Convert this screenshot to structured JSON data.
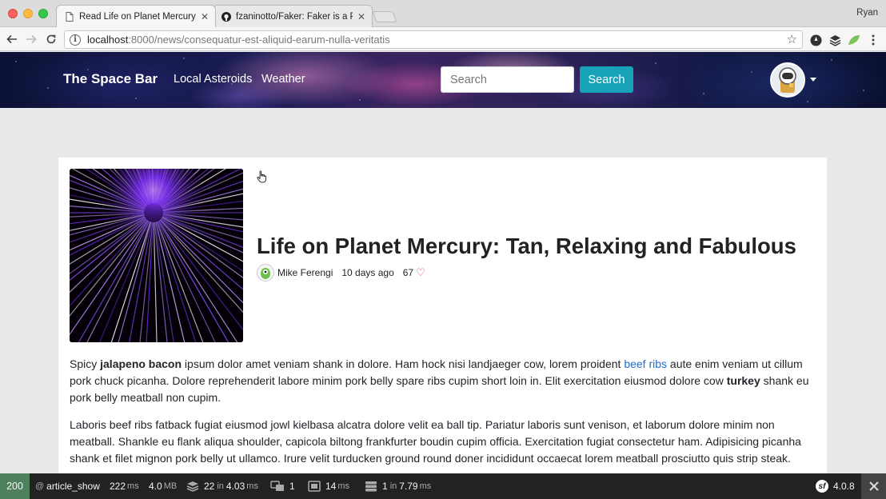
{
  "browser": {
    "tabs": [
      {
        "title": "Read Life on Planet Mercury: T",
        "active": true
      },
      {
        "title": "fzaninotto/Faker: Faker is a PH",
        "active": false
      }
    ],
    "user": "Ryan",
    "url": {
      "host": "localhost",
      "path": ":8000/news/consequatur-est-aliquid-earum-nulla-veritatis"
    }
  },
  "site": {
    "brand": "The Space Bar",
    "nav": [
      "Local Asteroids",
      "Weather"
    ],
    "search": {
      "placeholder": "Search",
      "button": "Search"
    }
  },
  "article": {
    "title": "Life on Planet Mercury: Tan, Relaxing and Fabulous",
    "author": "Mike Ferengi",
    "published": "10 days ago",
    "hearts": "67",
    "p1": {
      "a": "Spicy ",
      "b1": "jalapeno bacon",
      "c": " ipsum dolor amet veniam shank in dolore. Ham hock nisi landjaeger cow, lorem proident ",
      "link": "beef ribs",
      "d": " aute enim veniam ut cillum pork chuck picanha. Dolore reprehenderit labore minim pork belly spare ribs cupim short loin in. Elit exercitation eiusmod dolore cow ",
      "b2": "turkey",
      "e": " shank eu pork belly meatball non cupim."
    },
    "p2": "Laboris beef ribs fatback fugiat eiusmod jowl kielbasa alcatra dolore velit ea ball tip. Pariatur laboris sunt venison, et laborum dolore minim non meatball. Shankle eu flank aliqua shoulder, capicola biltong frankfurter boudin cupim officia. Exercitation fugiat consectetur ham. Adipisicing picanha shank et filet mignon pork belly ut ullamco. Irure velit turducken ground round doner incididunt occaecat lorem meatball prosciutto quis strip steak."
  },
  "profiler": {
    "status": "200",
    "route_prefix": "@",
    "route": "article_show",
    "time": "222",
    "time_unit": "ms",
    "memory": "4.0",
    "memory_unit": "MB",
    "db_queries": "22",
    "db_in": "in",
    "db_time": "4.03",
    "db_unit": "ms",
    "translations": "1",
    "render_time": "14",
    "render_unit": "ms",
    "cache": "1",
    "cache_in": "in",
    "cache_time": "7.79",
    "cache_unit": "ms",
    "symfony_version": "4.0.8"
  },
  "colors": {
    "status_ok": "#4f805d",
    "search_button": "#17a2b8",
    "heart": "#dc3545",
    "link": "#1e6fd0"
  }
}
